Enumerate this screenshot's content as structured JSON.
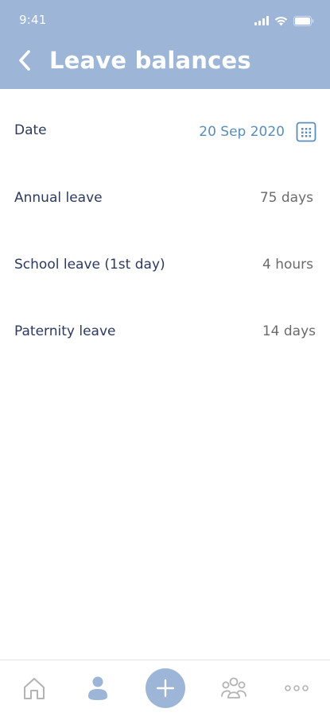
{
  "status_bar": {
    "time": "9:41"
  },
  "header": {
    "title": "Leave balances",
    "back_icon": "chevron-left-icon",
    "background_color": "#9db6d8"
  },
  "balances": {
    "date": {
      "label": "Date",
      "value": "20 Sep 2020",
      "icon": "calendar-icon"
    },
    "rows": [
      {
        "label": "Annual leave",
        "value": "75 days"
      },
      {
        "label": "School leave (1st day)",
        "value": "4 hours"
      },
      {
        "label": "Paternity leave",
        "value": "14 days"
      }
    ]
  },
  "tab_bar": {
    "items": [
      {
        "icon": "home-icon",
        "active": false
      },
      {
        "icon": "person-icon",
        "active": true
      },
      {
        "icon": "plus-icon",
        "active": false
      },
      {
        "icon": "team-icon",
        "active": false
      },
      {
        "icon": "more-icon",
        "active": false
      }
    ],
    "accent_color": "#9db6d8",
    "inactive_color": "#b3b3b3"
  }
}
